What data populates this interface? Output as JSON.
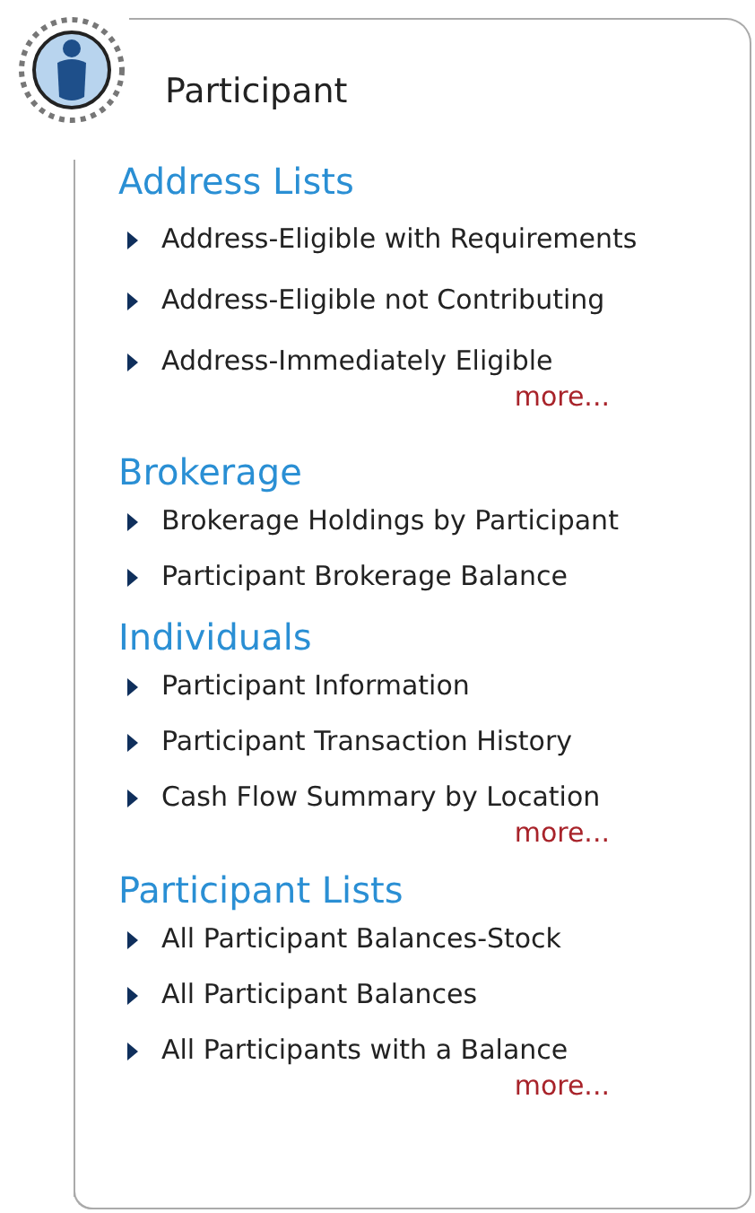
{
  "panel": {
    "title": "Participant"
  },
  "sections": [
    {
      "heading": "Address Lists",
      "items": [
        "Address-Eligible with Requirements",
        "Address-Eligible not Contributing",
        "Address-Immediately Eligible"
      ],
      "more": "more..."
    },
    {
      "heading": "Brokerage",
      "items": [
        "Brokerage Holdings by Participant",
        "Participant Brokerage Balance"
      ]
    },
    {
      "heading": "Individuals",
      "items": [
        "Participant Information",
        "Participant Transaction History",
        "Cash Flow Summary by Location"
      ],
      "more": "more..."
    },
    {
      "heading": "Participant Lists",
      "items": [
        "All Participant Balances-Stock",
        "All Participant Balances",
        "All Participants with a Balance"
      ],
      "more": "more..."
    }
  ]
}
